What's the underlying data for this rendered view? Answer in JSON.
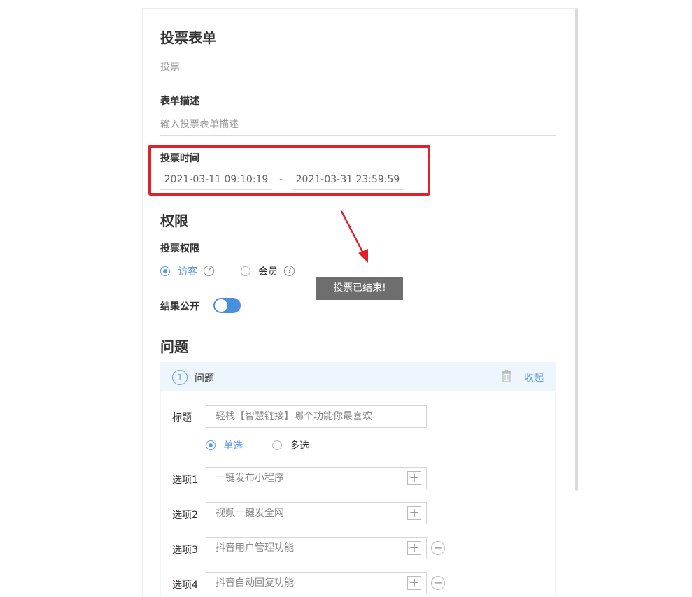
{
  "form": {
    "title": "投票表单",
    "name_value": "投票",
    "desc_label": "表单描述",
    "desc_placeholder": "输入投票表单描述",
    "time_label": "投票时间",
    "start_time": "2021-03-11 09:10:19",
    "separator": "-",
    "end_time": "2021-03-31 23:59:59"
  },
  "permissions": {
    "section_title": "权限",
    "vote_perm_label": "投票权限",
    "options": [
      {
        "label": "访客",
        "checked": true
      },
      {
        "label": "会员",
        "checked": false
      }
    ],
    "help_glyph": "?",
    "result_public_label": "结果公开",
    "result_public_on": true
  },
  "toast": "投票已结束!",
  "questions": {
    "section_title": "问题",
    "item": {
      "number": "1",
      "header": "问题",
      "collapse": "收起",
      "title_label": "标题",
      "title_value": "轻栈【智慧链接】哪个功能你最喜欢",
      "type_options": [
        {
          "label": "单选",
          "checked": true
        },
        {
          "label": "多选",
          "checked": false
        }
      ],
      "options": [
        {
          "label": "选项1",
          "value": "一键发布小程序"
        },
        {
          "label": "选项2",
          "value": "视频一键发全网"
        },
        {
          "label": "选项3",
          "value": "抖音用户管理功能"
        },
        {
          "label": "选项4",
          "value": "抖音自动回复功能"
        }
      ]
    }
  },
  "colors": {
    "accent": "#5a9be6",
    "highlight": "#e0202a",
    "toast_bg": "#6e6e6e"
  }
}
